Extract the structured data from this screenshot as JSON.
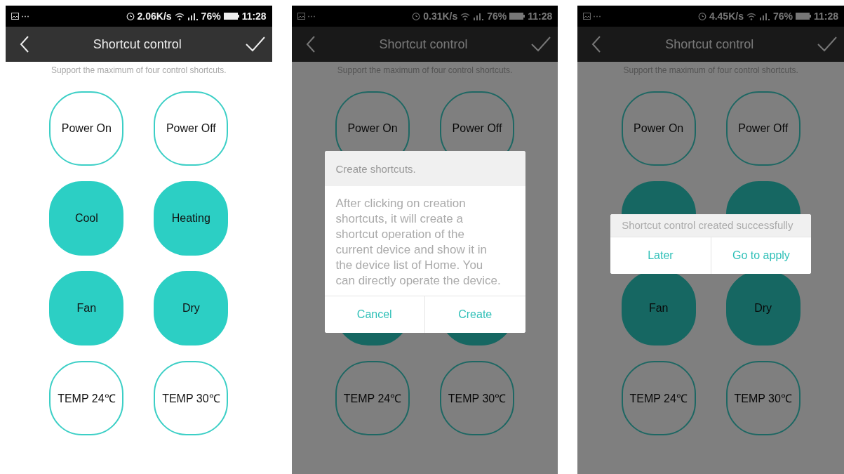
{
  "screens": [
    {
      "status_bar": {
        "speed": "2.06K/s",
        "battery": "76%",
        "time": "11:28"
      },
      "header": {
        "title": "Shortcut control"
      },
      "subtitle": "Support the maximum of four control shortcuts.",
      "shortcuts": [
        {
          "label": "Power On",
          "selected": false
        },
        {
          "label": "Power Off",
          "selected": false
        },
        {
          "label": "Cool",
          "selected": true
        },
        {
          "label": "Heating",
          "selected": true
        },
        {
          "label": "Fan",
          "selected": true
        },
        {
          "label": "Dry",
          "selected": true
        },
        {
          "label": "TEMP 24℃",
          "selected": false
        },
        {
          "label": "TEMP 30℃",
          "selected": false
        }
      ]
    },
    {
      "status_bar": {
        "speed": "0.31K/s",
        "battery": "76%",
        "time": "11:28"
      },
      "header": {
        "title": "Shortcut control"
      },
      "subtitle": "Support the maximum of four control shortcuts.",
      "shortcuts": [
        {
          "label": "Power On",
          "selected": false
        },
        {
          "label": "Power Off",
          "selected": false
        },
        {
          "selected": true
        },
        {
          "selected": true
        },
        {
          "label": "TEMP 24℃",
          "selected": false
        },
        {
          "label": "TEMP 30℃",
          "selected": false
        }
      ],
      "dialog": {
        "title": "Create shortcuts.",
        "message": "After clicking on creation shortcuts, it will create a shortcut operation of the current device and show it in the device list of Home. You can directly operate the device.",
        "buttons": [
          "Cancel",
          "Create"
        ]
      }
    },
    {
      "status_bar": {
        "speed": "4.45K/s",
        "battery": "76%",
        "time": "11:28"
      },
      "header": {
        "title": "Shortcut control"
      },
      "subtitle": "Support the maximum of four control shortcuts.",
      "shortcuts": [
        {
          "label": "Power On",
          "selected": false
        },
        {
          "label": "Power Off",
          "selected": false
        },
        {
          "selected": true
        },
        {
          "selected": true
        },
        {
          "label": "Fan",
          "selected": true
        },
        {
          "label": "Dry",
          "selected": true
        },
        {
          "label": "TEMP 24℃",
          "selected": false
        },
        {
          "label": "TEMP 30℃",
          "selected": false
        }
      ],
      "dialog": {
        "message": "Shortcut control created successfully",
        "buttons": [
          "Later",
          "Go to apply"
        ]
      }
    }
  ]
}
